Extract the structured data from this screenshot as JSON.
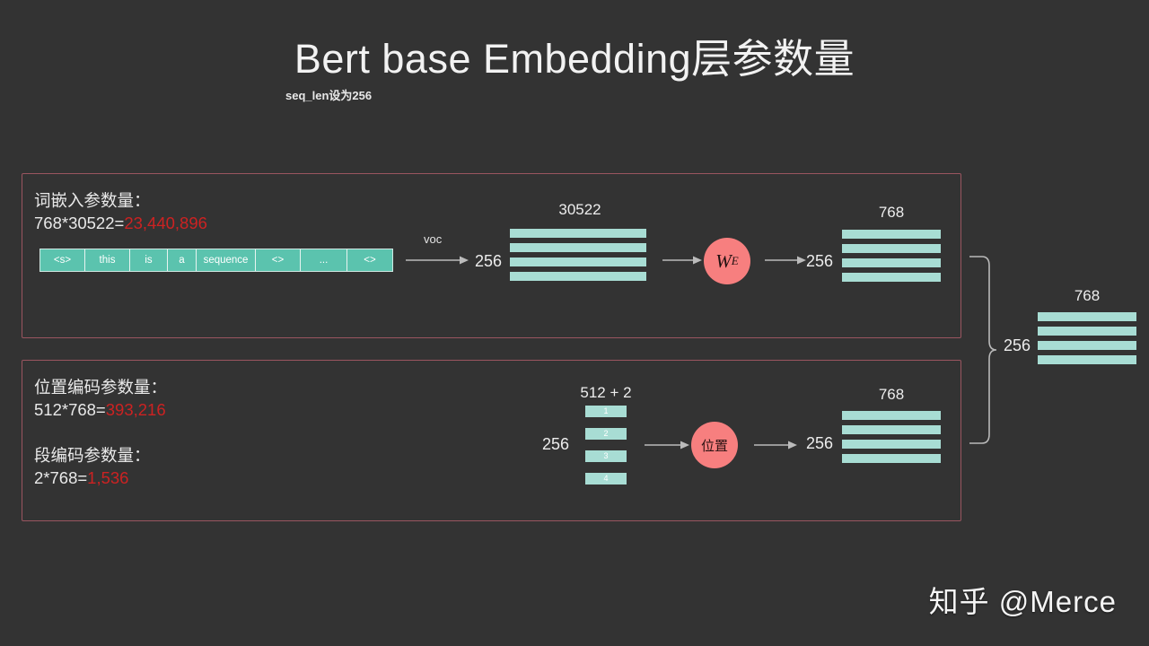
{
  "header": {
    "title": "Bert base Embedding层参数量",
    "subtitle": "seq_len设为256"
  },
  "colors": {
    "background": "#333333",
    "panel_border": "#9a5560",
    "bar_teal": "#a8ddd4",
    "token_teal": "#5bc3ae",
    "circle_salmon": "#f77f7f",
    "highlight_red": "#cc2222",
    "text": "#ededed"
  },
  "word_panel": {
    "heading": "词嵌入参数量：",
    "formula_prefix": "768*30522=",
    "formula_value": "23,440,896",
    "tokens": [
      "<s>",
      "this",
      "is",
      "a",
      "sequence",
      "<>",
      "...",
      "<>"
    ],
    "arrow_label": "voc",
    "input_dim": "256",
    "matrix_in_label": "30522",
    "op_label": "W",
    "op_label_sub": "E",
    "output_dim": "256",
    "matrix_out_label": "768"
  },
  "position_panel": {
    "heading_pos": "位置编码参数量：",
    "formula_pos_prefix": "512*768=",
    "formula_pos_value": "393,216",
    "heading_seg": "段编码参数量：",
    "formula_seg_prefix": "2*768=",
    "formula_seg_value": "1,536",
    "input_dim": "256",
    "matrix_in_label": "512 + 2",
    "row_numbers": [
      "1",
      "2",
      "3",
      "4"
    ],
    "op_label": "位置",
    "output_dim": "256",
    "matrix_out_label": "768"
  },
  "combined_output": {
    "brace_label": "256",
    "matrix_label": "768"
  },
  "watermark": "知乎 @Merce"
}
